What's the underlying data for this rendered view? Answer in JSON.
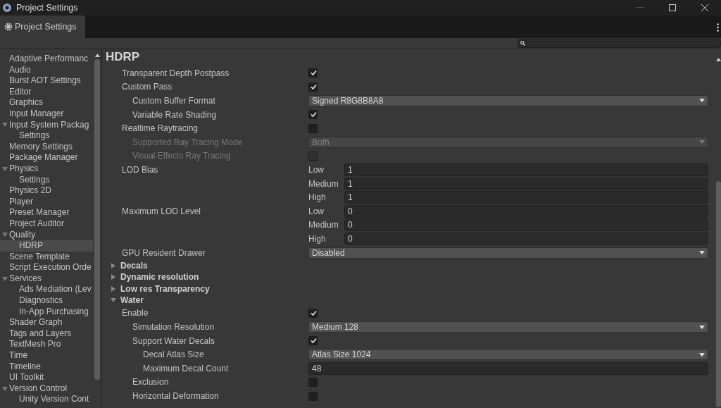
{
  "window": {
    "title": "Project Settings"
  },
  "tabs": [
    {
      "label": "Project Settings",
      "selected": true
    }
  ],
  "sidebar": {
    "items": [
      {
        "label": "Adaptive Performanc",
        "selected": false
      },
      {
        "label": "Audio",
        "selected": false
      },
      {
        "label": "Burst AOT Settings",
        "selected": false
      },
      {
        "label": "Editor",
        "selected": false
      },
      {
        "label": "Graphics",
        "selected": false
      },
      {
        "label": "Input Manager",
        "selected": false
      },
      {
        "label": "Input System Packag",
        "selected": false,
        "expanded": true,
        "children": [
          {
            "label": "Settings",
            "selected": false
          }
        ]
      },
      {
        "label": "Memory Settings",
        "selected": false
      },
      {
        "label": "Package Manager",
        "selected": false
      },
      {
        "label": "Physics",
        "selected": false,
        "expanded": true,
        "children": [
          {
            "label": "Settings",
            "selected": false
          }
        ]
      },
      {
        "label": "Physics 2D",
        "selected": false
      },
      {
        "label": "Player",
        "selected": false
      },
      {
        "label": "Preset Manager",
        "selected": false
      },
      {
        "label": "Project Auditor",
        "selected": false
      },
      {
        "label": "Quality",
        "selected": false,
        "expanded": true,
        "children": [
          {
            "label": "HDRP",
            "selected": true
          }
        ]
      },
      {
        "label": "Scene Template",
        "selected": false
      },
      {
        "label": "Script Execution Orde",
        "selected": false
      },
      {
        "label": "Services",
        "selected": false,
        "expanded": true,
        "children": [
          {
            "label": "Ads Mediation (Lev",
            "selected": false
          },
          {
            "label": "Diagnostics",
            "selected": false
          },
          {
            "label": "In-App Purchasing",
            "selected": false
          }
        ]
      },
      {
        "label": "Shader Graph",
        "selected": false
      },
      {
        "label": "Tags and Layers",
        "selected": false
      },
      {
        "label": "TextMesh Pro",
        "selected": false
      },
      {
        "label": "Time",
        "selected": false
      },
      {
        "label": "Timeline",
        "selected": false
      },
      {
        "label": "UI Toolkit",
        "selected": false
      },
      {
        "label": "Version Control",
        "selected": false,
        "expanded": true,
        "children": [
          {
            "label": "Unity Version Cont",
            "selected": false
          }
        ]
      }
    ]
  },
  "panel": {
    "title": "HDRP",
    "settings": [
      {
        "kind": "checkbox",
        "label": "Transparent Depth Postpass",
        "checked": true,
        "disabled": false
      },
      {
        "kind": "checkbox",
        "label": "Custom Pass",
        "checked": true,
        "disabled": false,
        "children": [
          {
            "kind": "dropdown",
            "label": "Custom Buffer Format",
            "value": "Signed R8G8B8A8",
            "disabled": false
          },
          {
            "kind": "checkbox",
            "label": "Variable Rate Shading",
            "checked": true,
            "disabled": false
          }
        ]
      },
      {
        "kind": "checkbox",
        "label": "Realtime Raytracing",
        "checked": false,
        "disabled": false,
        "children": [
          {
            "kind": "dropdown",
            "label": "Supported Ray Tracing Mode",
            "value": "Both",
            "disabled": true
          },
          {
            "kind": "checkbox",
            "label": "Visual Effects Ray Tracing",
            "checked": false,
            "disabled": true
          }
        ]
      },
      {
        "kind": "levels",
        "label": "LOD Bias",
        "levels": [
          {
            "label": "Low",
            "value": "1"
          },
          {
            "label": "Medium",
            "value": "1"
          },
          {
            "label": "High",
            "value": "1"
          }
        ]
      },
      {
        "kind": "levels",
        "label": "Maximum LOD Level",
        "levels": [
          {
            "label": "Low",
            "value": "0"
          },
          {
            "label": "Medium",
            "value": "0"
          },
          {
            "label": "High",
            "value": "0"
          }
        ]
      },
      {
        "kind": "dropdown",
        "label": "GPU Resident Drawer",
        "value": "Disabled",
        "disabled": false
      },
      {
        "kind": "foldout",
        "label": "Decals",
        "expanded": false
      },
      {
        "kind": "foldout",
        "label": "Dynamic resolution",
        "expanded": false
      },
      {
        "kind": "foldout",
        "label": "Low res Transparency",
        "expanded": false
      },
      {
        "kind": "foldout",
        "label": "Water",
        "expanded": true,
        "children": [
          {
            "kind": "checkbox",
            "label": "Enable",
            "checked": true,
            "disabled": false,
            "children": [
              {
                "kind": "dropdown",
                "label": "Simulation Resolution",
                "value": "Medium 128",
                "disabled": false
              },
              {
                "kind": "checkbox",
                "label": "Support Water Decals",
                "checked": true,
                "disabled": false,
                "children": [
                  {
                    "kind": "dropdown",
                    "label": "Decal Atlas Size",
                    "value": "Atlas Size 1024",
                    "disabled": false
                  },
                  {
                    "kind": "number",
                    "label": "Maximum Decal Count",
                    "value": "48"
                  }
                ]
              },
              {
                "kind": "checkbox",
                "label": "Exclusion",
                "checked": false,
                "disabled": false
              },
              {
                "kind": "checkbox",
                "label": "Horizontal Deformation",
                "checked": false,
                "disabled": false
              }
            ]
          }
        ]
      }
    ]
  }
}
